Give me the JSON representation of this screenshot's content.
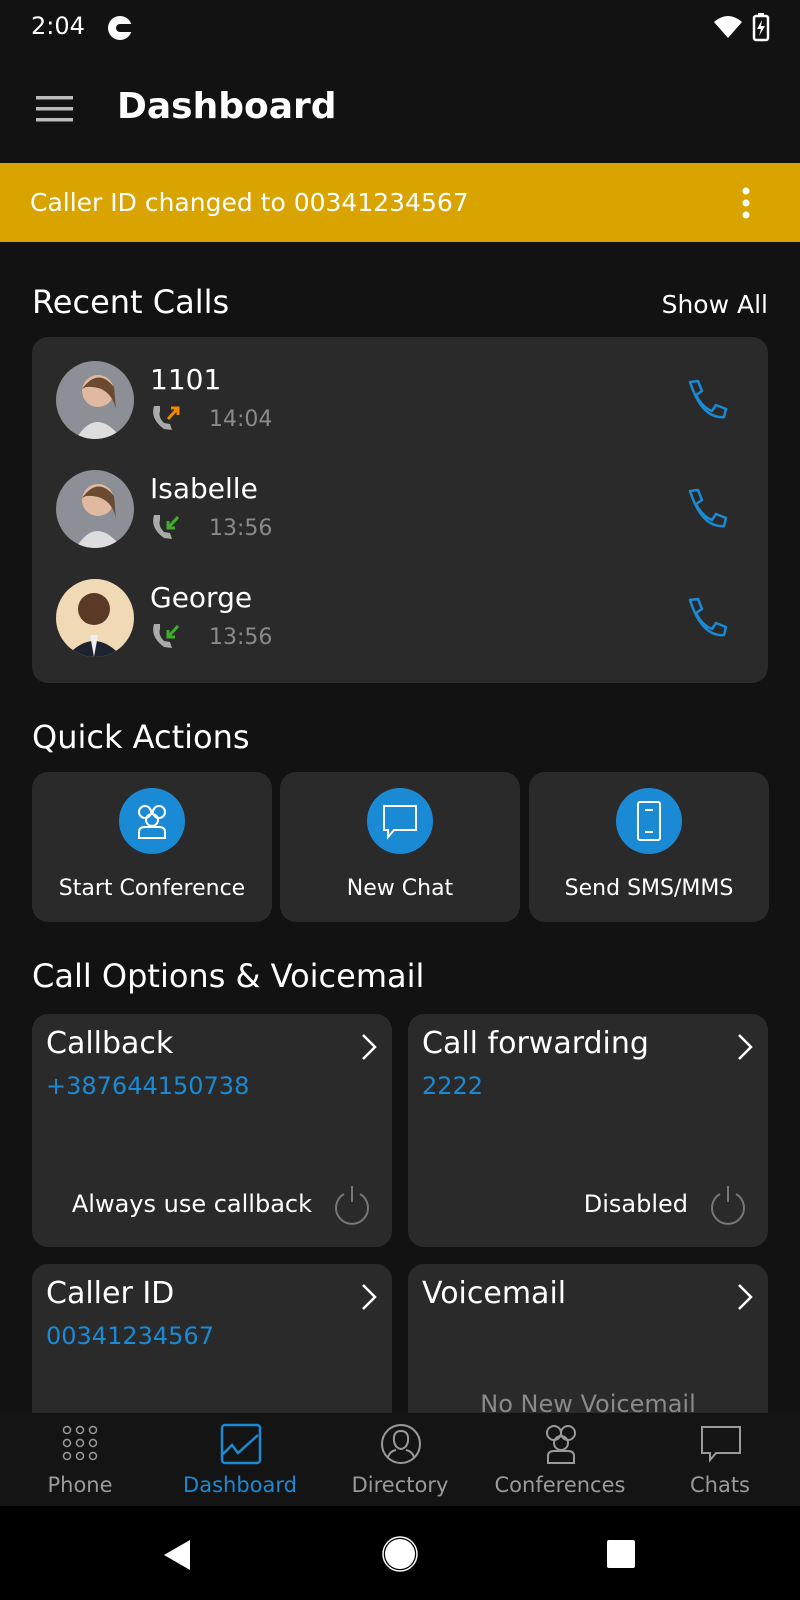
{
  "status_bar": {
    "time": "2:04"
  },
  "app_bar": {
    "title": "Dashboard"
  },
  "banner": {
    "text": "Caller ID changed to 00341234567",
    "color": "#d9a400"
  },
  "recent_calls": {
    "title": "Recent Calls",
    "show_all": "Show All",
    "items": [
      {
        "name": "1101",
        "time": "14:04",
        "direction": "outgoing",
        "direction_color": "#f08a00"
      },
      {
        "name": "Isabelle",
        "time": "13:56",
        "direction": "incoming",
        "direction_color": "#3fae2a"
      },
      {
        "name": "George",
        "time": "13:56",
        "direction": "incoming",
        "direction_color": "#3fae2a"
      }
    ]
  },
  "quick_actions": {
    "title": "Quick Actions",
    "items": [
      {
        "label": "Start Conference",
        "icon": "conference-icon"
      },
      {
        "label": "New Chat",
        "icon": "chat-icon"
      },
      {
        "label": "Send SMS/MMS",
        "icon": "mobile-icon"
      }
    ]
  },
  "call_options": {
    "title": "Call Options & Voicemail",
    "items": [
      {
        "title": "Callback",
        "value": "+387644150738",
        "footer": "Always use callback"
      },
      {
        "title": "Call forwarding",
        "value": "2222",
        "footer": "Disabled"
      },
      {
        "title": "Caller ID",
        "value": "00341234567"
      },
      {
        "title": "Voicemail",
        "footer": "No New Voicemail"
      }
    ]
  },
  "bottom_nav": {
    "active": "Dashboard",
    "items": [
      "Phone",
      "Dashboard",
      "Directory",
      "Conferences",
      "Chats"
    ]
  },
  "accent": "#1a8ad4"
}
